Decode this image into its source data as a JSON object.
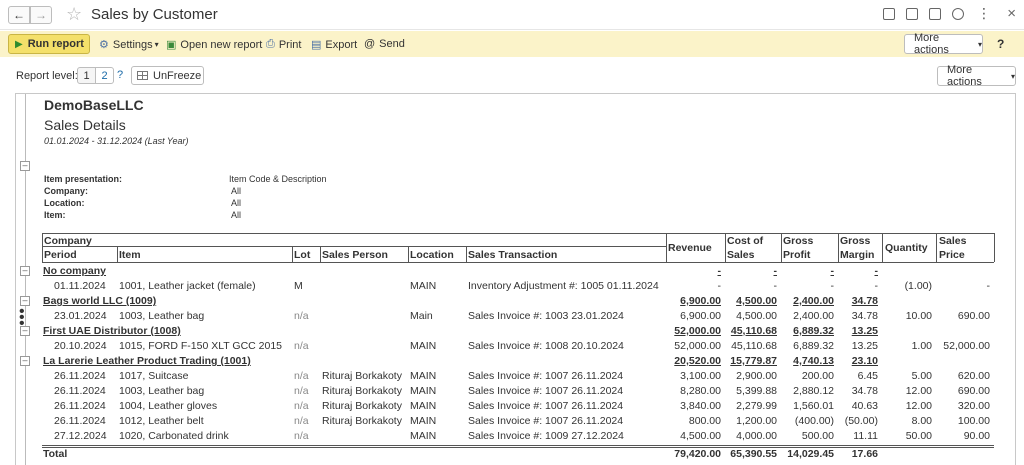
{
  "window": {
    "title": "Sales by Customer",
    "back_icon": "arrow-left-icon",
    "forward_icon": "arrow-right-icon"
  },
  "toolbar": {
    "run_report": "Run report",
    "settings": "Settings",
    "open_new_report": "Open new report",
    "print": "Print",
    "export": "Export",
    "send": "Send",
    "more_actions": "More actions",
    "help": "?"
  },
  "level_row": {
    "label": "Report level:",
    "level1": "1",
    "level2": "2",
    "help": "?",
    "unfreeze": "UnFreeze",
    "more_actions": "More actions"
  },
  "report": {
    "company": "DemoBaseLLC",
    "title": "Sales Details",
    "period": "01.01.2024 - 31.12.2024 (Last Year)",
    "params": [
      {
        "label": "Item presentation:",
        "value": "Item Code & Description"
      },
      {
        "label": "Company:",
        "value": "All"
      },
      {
        "label": "Location:",
        "value": "All"
      },
      {
        "label": "Item:",
        "value": "All"
      }
    ],
    "headers": {
      "company": "Company",
      "period": "Period",
      "item": "Item",
      "lot": "Lot",
      "sales_person": "Sales Person",
      "location": "Location",
      "sales_transaction": "Sales Transaction",
      "revenue": "Revenue",
      "cost_of_sales": "Cost of Sales",
      "cost_1": "Cost of",
      "cost_2": "Sales",
      "gross_profit_1": "Gross",
      "gross_profit_2": "Profit",
      "gross_margin_1": "Gross",
      "gross_margin_2": "Margin",
      "quantity": "Quantity",
      "sales_price_1": "Sales",
      "sales_price_2": "Price"
    },
    "groups": [
      {
        "name": "No company",
        "revenue": "-",
        "cost": "-",
        "profit": "-",
        "margin": "-",
        "rows": [
          {
            "period": "01.11.2024",
            "item": "1001, Leather jacket (female)",
            "lot": "M",
            "person": "",
            "location": "MAIN",
            "transaction": "Inventory Adjustment #: 1005 01.11.2024",
            "revenue": "-",
            "cost": "-",
            "profit": "-",
            "margin": "-",
            "qty": "(1.00)",
            "price": "-"
          }
        ]
      },
      {
        "name": "Bags world LLC (1009)",
        "revenue": "6,900.00",
        "cost": "4,500.00",
        "profit": "2,400.00",
        "margin": "34.78",
        "rows": [
          {
            "period": "23.01.2024",
            "item": "1003, Leather bag",
            "lot": "n/a",
            "person": "",
            "location": "Main",
            "transaction": "Sales Invoice #: 1003 23.01.2024",
            "revenue": "6,900.00",
            "cost": "4,500.00",
            "profit": "2,400.00",
            "margin": "34.78",
            "qty": "10.00",
            "price": "690.00"
          }
        ]
      },
      {
        "name": "First UAE Distributor (1008)",
        "revenue": "52,000.00",
        "cost": "45,110.68",
        "profit": "6,889.32",
        "margin": "13.25",
        "rows": [
          {
            "period": "20.10.2024",
            "item": "1015, FORD F-150 XLT GCC 2015",
            "lot": "n/a",
            "person": "",
            "location": "MAIN",
            "transaction": "Sales Invoice #: 1008 20.10.2024",
            "revenue": "52,000.00",
            "cost": "45,110.68",
            "profit": "6,889.32",
            "margin": "13.25",
            "qty": "1.00",
            "price": "52,000.00"
          }
        ]
      },
      {
        "name": "La Larerie Leather Product Trading (1001)",
        "revenue": "20,520.00",
        "cost": "15,779.87",
        "profit": "4,740.13",
        "margin": "23.10",
        "rows": [
          {
            "period": "26.11.2024",
            "item": "1017, Suitcase",
            "lot": "n/a",
            "person": "Rituraj Borkakoty",
            "location": "MAIN",
            "transaction": "Sales Invoice #: 1007 26.11.2024",
            "revenue": "3,100.00",
            "cost": "2,900.00",
            "profit": "200.00",
            "margin": "6.45",
            "qty": "5.00",
            "price": "620.00"
          },
          {
            "period": "26.11.2024",
            "item": "1003, Leather bag",
            "lot": "n/a",
            "person": "Rituraj Borkakoty",
            "location": "MAIN",
            "transaction": "Sales Invoice #: 1007 26.11.2024",
            "revenue": "8,280.00",
            "cost": "5,399.88",
            "profit": "2,880.12",
            "margin": "34.78",
            "qty": "12.00",
            "price": "690.00"
          },
          {
            "period": "26.11.2024",
            "item": "1004, Leather gloves",
            "lot": "n/a",
            "person": "Rituraj Borkakoty",
            "location": "MAIN",
            "transaction": "Sales Invoice #: 1007 26.11.2024",
            "revenue": "3,840.00",
            "cost": "2,279.99",
            "profit": "1,560.01",
            "margin": "40.63",
            "qty": "12.00",
            "price": "320.00"
          },
          {
            "period": "26.11.2024",
            "item": "1012, Leather belt",
            "lot": "n/a",
            "person": "Rituraj Borkakoty",
            "location": "MAIN",
            "transaction": "Sales Invoice #: 1007 26.11.2024",
            "revenue": "800.00",
            "cost": "1,200.00",
            "profit": "(400.00)",
            "margin": "(50.00)",
            "qty": "8.00",
            "price": "100.00"
          },
          {
            "period": "27.12.2024",
            "item": "1020, Carbonated drink",
            "lot": "n/a",
            "person": "",
            "location": "MAIN",
            "transaction": "Sales Invoice #: 1009 27.12.2024",
            "revenue": "4,500.00",
            "cost": "4,000.00",
            "profit": "500.00",
            "margin": "11.11",
            "qty": "50.00",
            "price": "90.00"
          }
        ]
      }
    ],
    "total": {
      "label": "Total",
      "revenue": "79,420.00",
      "cost": "65,390.55",
      "profit": "14,029.45",
      "margin": "17.66"
    }
  }
}
